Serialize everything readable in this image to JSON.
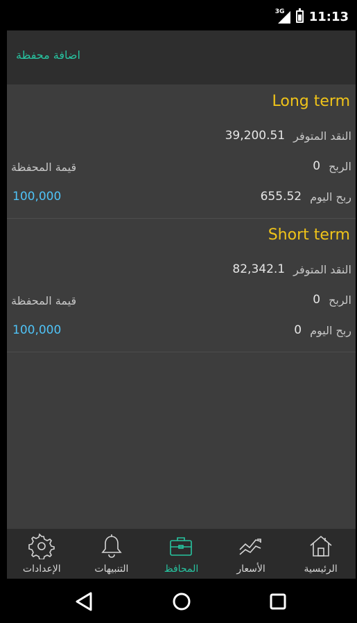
{
  "status_bar": {
    "network": "3G",
    "time": "11:13"
  },
  "app_bar": {
    "add_portfolio": "اضافة محفظة"
  },
  "portfolios": [
    {
      "name": "Long term",
      "cash_label": "النقد المتوفر",
      "cash_value": "39,200.51",
      "profit_label": "الربح",
      "profit_value": "0",
      "portfolio_value_label": "قيمة المحفظة",
      "today_profit_label": "ربح اليوم",
      "today_profit_value": "655.52",
      "portfolio_value": "100,000"
    },
    {
      "name": "Short term",
      "cash_label": "النقد المتوفر",
      "cash_value": "82,342.1",
      "profit_label": "الربح",
      "profit_value": "0",
      "portfolio_value_label": "قيمة المحفظة",
      "today_profit_label": "ربح اليوم",
      "today_profit_value": "0",
      "portfolio_value": "100,000"
    }
  ],
  "bottom_nav": {
    "settings": "الإعدادات",
    "alerts": "التنبيهات",
    "portfolios": "المحافظ",
    "prices": "الأسعار",
    "home": "الرئيسية"
  },
  "colors": {
    "accent": "#27c4a0",
    "title": "#f0c419",
    "value_blue": "#4fc3f7",
    "background": "#3d3d3d"
  }
}
